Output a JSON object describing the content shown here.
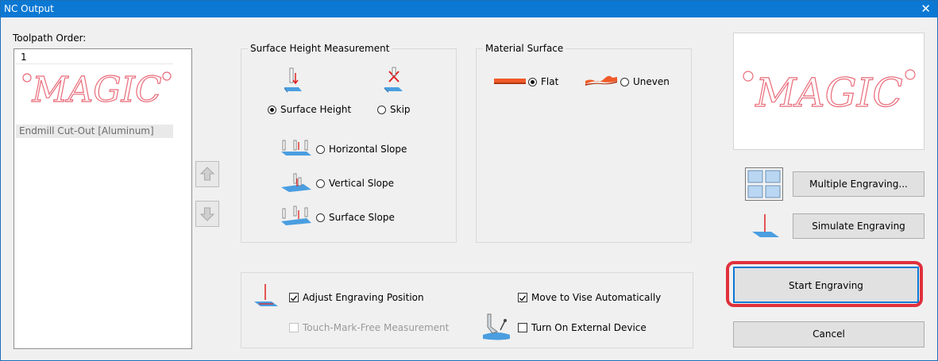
{
  "window": {
    "title": "NC Output",
    "close_glyph": "✕"
  },
  "toolpath": {
    "label": "Toolpath Order:",
    "item_index": "1",
    "item_text": "MAGIC",
    "item_caption": "Endmill Cut-Out [Aluminum]"
  },
  "surface_height": {
    "title": "Surface Height Measurement",
    "options": {
      "surface_height": "Surface Height",
      "skip": "Skip",
      "horizontal_slope": "Horizontal Slope",
      "vertical_slope": "Vertical Slope",
      "surface_slope": "Surface Slope"
    },
    "selected": "surface_height"
  },
  "material_surface": {
    "title": "Material Surface",
    "options": {
      "flat": "Flat",
      "uneven": "Uneven"
    },
    "selected": "flat"
  },
  "options": {
    "adjust_position": "Adjust Engraving Position",
    "touch_mark_free": "Touch-Mark-Free Measurement",
    "move_to_vise": "Move to Vise Automatically",
    "turn_on_device": "Turn On External Device"
  },
  "preview": {
    "text": "MAGIC"
  },
  "buttons": {
    "multiple_engraving": "Multiple Engraving...",
    "simulate_engraving": "Simulate Engraving",
    "start_engraving": "Start Engraving",
    "cancel": "Cancel"
  },
  "colors": {
    "accent": "#0b78d4",
    "highlight": "#e0303c",
    "engrave_pink": "#e96b7a"
  }
}
